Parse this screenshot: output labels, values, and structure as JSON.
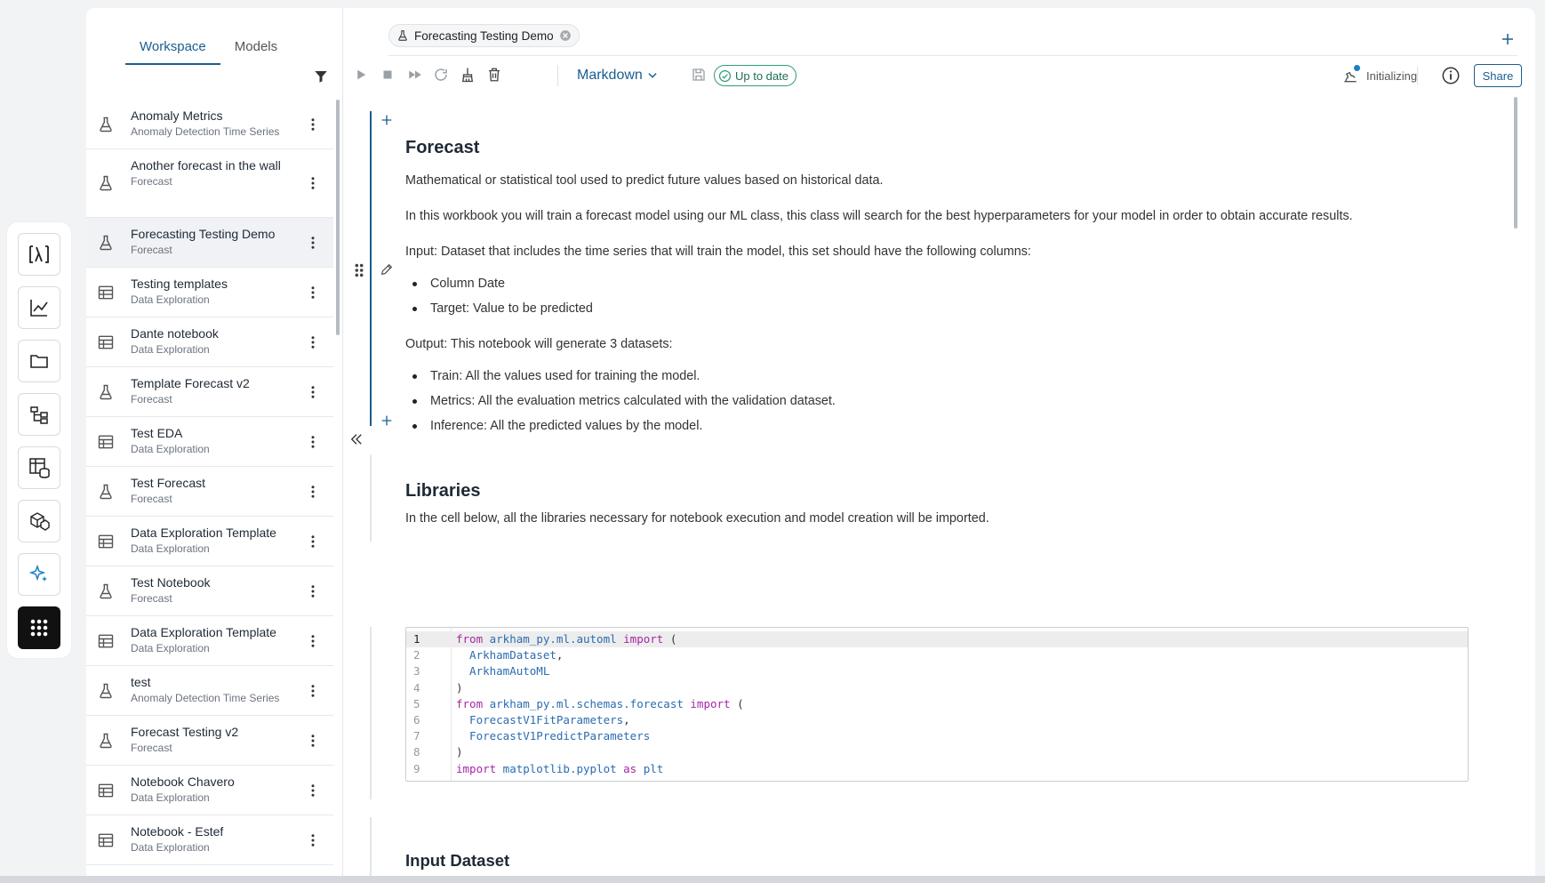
{
  "rail": {
    "items": [
      {
        "name": "logo",
        "icon": "lambda-logo-icon"
      },
      {
        "name": "charts",
        "icon": "line-chart-icon"
      },
      {
        "name": "files",
        "icon": "folder-icon"
      },
      {
        "name": "pipelines",
        "icon": "flow-icon"
      },
      {
        "name": "datasets",
        "icon": "table-database-icon"
      },
      {
        "name": "models",
        "icon": "cubes-icon"
      },
      {
        "name": "ai",
        "icon": "sparkle-icon"
      },
      {
        "name": "apps",
        "icon": "grid-dots-icon"
      }
    ]
  },
  "sidebar": {
    "tabs": [
      {
        "label": "Workspace",
        "active": true
      },
      {
        "label": "Models",
        "active": false
      }
    ],
    "items": [
      {
        "title": "Anomaly Metrics",
        "subtitle": "Anomaly Detection Time Series",
        "icon": "flask-icon"
      },
      {
        "title": "Another forecast in the wall",
        "subtitle": "Forecast",
        "icon": "flask-icon"
      },
      {
        "title": "Forecasting Testing Demo",
        "subtitle": "Forecast",
        "icon": "flask-icon"
      },
      {
        "title": "Testing templates",
        "subtitle": "Data Exploration",
        "icon": "table-icon"
      },
      {
        "title": "Dante notebook",
        "subtitle": "Data Exploration",
        "icon": "table-icon"
      },
      {
        "title": "Template Forecast v2",
        "subtitle": "Forecast",
        "icon": "flask-icon"
      },
      {
        "title": "Test EDA",
        "subtitle": "Data Exploration",
        "icon": "table-icon"
      },
      {
        "title": "Test Forecast",
        "subtitle": "Forecast",
        "icon": "flask-icon"
      },
      {
        "title": "Data Exploration Template",
        "subtitle": "Data Exploration",
        "icon": "table-icon"
      },
      {
        "title": "Test Notebook",
        "subtitle": "Forecast",
        "icon": "flask-icon"
      },
      {
        "title": "Data Exploration Template",
        "subtitle": "Data Exploration",
        "icon": "table-icon"
      },
      {
        "title": "test",
        "subtitle": "Anomaly Detection Time Series",
        "icon": "flask-icon"
      },
      {
        "title": "Forecast Testing v2",
        "subtitle": "Forecast",
        "icon": "flask-icon"
      },
      {
        "title": "Notebook Chavero",
        "subtitle": "Data Exploration",
        "icon": "table-icon"
      },
      {
        "title": "Notebook - Estef",
        "subtitle": "Data Exploration",
        "icon": "table-icon"
      }
    ]
  },
  "notebook": {
    "tab_label": "Forecasting Testing Demo",
    "mode": "Markdown",
    "status": "Up to date",
    "kernel_status": "Initializing",
    "share_label": "Share"
  },
  "cells": {
    "forecast": {
      "heading": "Forecast",
      "p1": "Mathematical or statistical tool used to predict future values based on historical data.",
      "p2": "In this workbook you will train a forecast model using our ML class, this class will search for the best hyperparameters for your model in order to obtain accurate results.",
      "p3": "Input: Dataset that includes the time series that will train the model, this set should have the following columns:",
      "input_bullets": [
        "Column Date",
        "Target: Value to be predicted"
      ],
      "p4": "Output: This notebook will generate 3 datasets:",
      "output_bullets": [
        "Train: All the values used for training the model.",
        "Metrics: All the evaluation metrics calculated with the validation dataset.",
        "Inference: All the predicted values by the model."
      ]
    },
    "libraries": {
      "heading": "Libraries",
      "p1": "In the cell below, all the libraries necessary for notebook execution and model creation will be imported."
    },
    "code": {
      "line_numbers": [
        "1",
        "2",
        "3",
        "4",
        "5",
        "6",
        "7",
        "8",
        "9"
      ],
      "lines": [
        "from arkham_py.ml.automl import (",
        "  ArkhamDataset,",
        "  ArkhamAutoML",
        ")",
        "from arkham_py.ml.schemas.forecast import (",
        "  ForecastV1FitParameters,",
        "  ForecastV1PredictParameters",
        ")",
        "import matplotlib.pyplot as plt"
      ]
    },
    "input_dataset": {
      "heading": "Input Dataset"
    }
  },
  "colors": {
    "accent": "#1b5e8f",
    "success": "#2e9d74"
  }
}
